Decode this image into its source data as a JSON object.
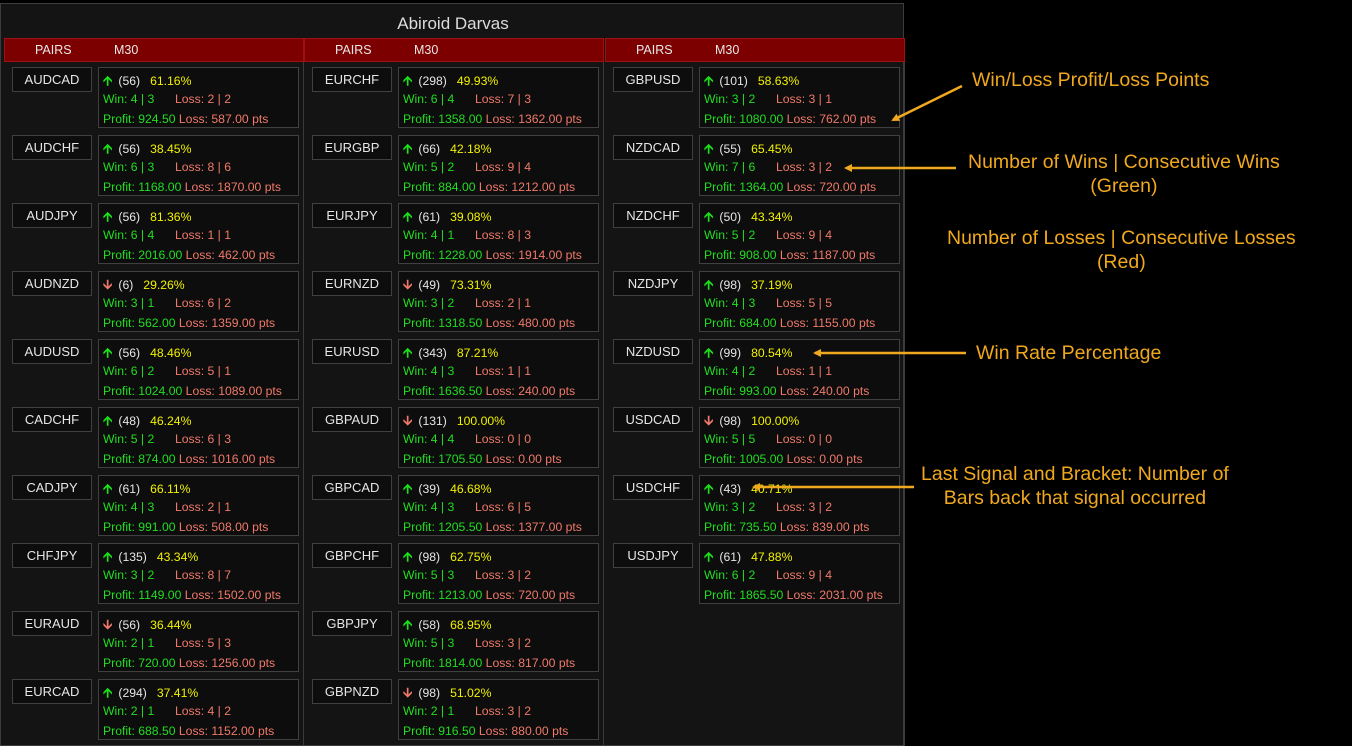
{
  "title": "Abiroid Darvas",
  "header": {
    "pairs_label": "PAIRS",
    "timeframe": "M30"
  },
  "columns": [
    [
      {
        "pair": "AUDCAD",
        "dir": "up",
        "bars": "(56)",
        "rate": "61.16%",
        "win": "Win: 4 | 3",
        "loss": "Loss: 2 | 2",
        "profit": "Profit: 924.50",
        "lossp": "Loss: 587.00 pts"
      },
      {
        "pair": "AUDCHF",
        "dir": "up",
        "bars": "(56)",
        "rate": "38.45%",
        "win": "Win: 6 | 3",
        "loss": "Loss: 8 | 6",
        "profit": "Profit: 1168.00",
        "lossp": "Loss: 1870.00 pts"
      },
      {
        "pair": "AUDJPY",
        "dir": "up",
        "bars": "(56)",
        "rate": "81.36%",
        "win": "Win: 6 | 4",
        "loss": "Loss: 1 | 1",
        "profit": "Profit: 2016.00",
        "lossp": "Loss: 462.00 pts"
      },
      {
        "pair": "AUDNZD",
        "dir": "down",
        "bars": "(6)",
        "rate": "29.26%",
        "win": "Win: 3 | 1",
        "loss": "Loss: 6 | 2",
        "profit": "Profit: 562.00",
        "lossp": "Loss: 1359.00 pts"
      },
      {
        "pair": "AUDUSD",
        "dir": "up",
        "bars": "(56)",
        "rate": "48.46%",
        "win": "Win: 6 | 2",
        "loss": "Loss: 5 | 1",
        "profit": "Profit: 1024.00",
        "lossp": "Loss: 1089.00 pts"
      },
      {
        "pair": "CADCHF",
        "dir": "up",
        "bars": "(48)",
        "rate": "46.24%",
        "win": "Win: 5 | 2",
        "loss": "Loss: 6 | 3",
        "profit": "Profit: 874.00",
        "lossp": "Loss: 1016.00 pts"
      },
      {
        "pair": "CADJPY",
        "dir": "up",
        "bars": "(61)",
        "rate": "66.11%",
        "win": "Win: 4 | 3",
        "loss": "Loss: 2 | 1",
        "profit": "Profit: 991.00",
        "lossp": "Loss: 508.00 pts"
      },
      {
        "pair": "CHFJPY",
        "dir": "up",
        "bars": "(135)",
        "rate": "43.34%",
        "win": "Win: 3 | 2",
        "loss": "Loss: 8 | 7",
        "profit": "Profit: 1149.00",
        "lossp": "Loss: 1502.00 pts"
      },
      {
        "pair": "EURAUD",
        "dir": "down",
        "bars": "(56)",
        "rate": "36.44%",
        "win": "Win: 2 | 1",
        "loss": "Loss: 5 | 3",
        "profit": "Profit: 720.00",
        "lossp": "Loss: 1256.00 pts"
      },
      {
        "pair": "EURCAD",
        "dir": "up",
        "bars": "(294)",
        "rate": "37.41%",
        "win": "Win: 2 | 1",
        "loss": "Loss: 4 | 2",
        "profit": "Profit: 688.50",
        "lossp": "Loss: 1152.00 pts"
      }
    ],
    [
      {
        "pair": "EURCHF",
        "dir": "up",
        "bars": "(298)",
        "rate": "49.93%",
        "win": "Win: 6 | 4",
        "loss": "Loss: 7 | 3",
        "profit": "Profit: 1358.00",
        "lossp": "Loss: 1362.00 pts"
      },
      {
        "pair": "EURGBP",
        "dir": "up",
        "bars": "(66)",
        "rate": "42.18%",
        "win": "Win: 5 | 2",
        "loss": "Loss: 9 | 4",
        "profit": "Profit: 884.00",
        "lossp": "Loss: 1212.00 pts"
      },
      {
        "pair": "EURJPY",
        "dir": "up",
        "bars": "(61)",
        "rate": "39.08%",
        "win": "Win: 4 | 1",
        "loss": "Loss: 8 | 3",
        "profit": "Profit: 1228.00",
        "lossp": "Loss: 1914.00 pts"
      },
      {
        "pair": "EURNZD",
        "dir": "down",
        "bars": "(49)",
        "rate": "73.31%",
        "win": "Win: 3 | 2",
        "loss": "Loss: 2 | 1",
        "profit": "Profit: 1318.50",
        "lossp": "Loss: 480.00 pts"
      },
      {
        "pair": "EURUSD",
        "dir": "up",
        "bars": "(343)",
        "rate": "87.21%",
        "win": "Win: 4 | 3",
        "loss": "Loss: 1 | 1",
        "profit": "Profit: 1636.50",
        "lossp": "Loss: 240.00 pts"
      },
      {
        "pair": "GBPAUD",
        "dir": "down",
        "bars": "(131)",
        "rate": "100.00%",
        "win": "Win: 4 | 4",
        "loss": "Loss: 0 | 0",
        "profit": "Profit: 1705.50",
        "lossp": "Loss: 0.00 pts"
      },
      {
        "pair": "GBPCAD",
        "dir": "up",
        "bars": "(39)",
        "rate": "46.68%",
        "win": "Win: 4 | 3",
        "loss": "Loss: 6 | 5",
        "profit": "Profit: 1205.50",
        "lossp": "Loss: 1377.00 pts"
      },
      {
        "pair": "GBPCHF",
        "dir": "up",
        "bars": "(98)",
        "rate": "62.75%",
        "win": "Win: 5 | 3",
        "loss": "Loss: 3 | 2",
        "profit": "Profit: 1213.00",
        "lossp": "Loss: 720.00 pts"
      },
      {
        "pair": "GBPJPY",
        "dir": "up",
        "bars": "(58)",
        "rate": "68.95%",
        "win": "Win: 5 | 3",
        "loss": "Loss: 3 | 2",
        "profit": "Profit: 1814.00",
        "lossp": "Loss: 817.00 pts"
      },
      {
        "pair": "GBPNZD",
        "dir": "down",
        "bars": "(98)",
        "rate": "51.02%",
        "win": "Win: 2 | 1",
        "loss": "Loss: 3 | 2",
        "profit": "Profit: 916.50",
        "lossp": "Loss: 880.00 pts"
      }
    ],
    [
      {
        "pair": "GBPUSD",
        "dir": "up",
        "bars": "(101)",
        "rate": "58.63%",
        "win": "Win: 3 | 2",
        "loss": "Loss: 3 | 1",
        "profit": "Profit: 1080.00",
        "lossp": "Loss: 762.00 pts"
      },
      {
        "pair": "NZDCAD",
        "dir": "up",
        "bars": "(55)",
        "rate": "65.45%",
        "win": "Win: 7 | 6",
        "loss": "Loss: 3 | 2",
        "profit": "Profit: 1364.00",
        "lossp": "Loss: 720.00 pts"
      },
      {
        "pair": "NZDCHF",
        "dir": "up",
        "bars": "(50)",
        "rate": "43.34%",
        "win": "Win: 5 | 2",
        "loss": "Loss: 9 | 4",
        "profit": "Profit: 908.00",
        "lossp": "Loss: 1187.00 pts"
      },
      {
        "pair": "NZDJPY",
        "dir": "up",
        "bars": "(98)",
        "rate": "37.19%",
        "win": "Win: 4 | 3",
        "loss": "Loss: 5 | 5",
        "profit": "Profit: 684.00",
        "lossp": "Loss: 1155.00 pts"
      },
      {
        "pair": "NZDUSD",
        "dir": "up",
        "bars": "(99)",
        "rate": "80.54%",
        "win": "Win: 4 | 2",
        "loss": "Loss: 1 | 1",
        "profit": "Profit: 993.00",
        "lossp": "Loss: 240.00 pts"
      },
      {
        "pair": "USDCAD",
        "dir": "down",
        "bars": "(98)",
        "rate": "100.00%",
        "win": "Win: 5 | 5",
        "loss": "Loss: 0 | 0",
        "profit": "Profit: 1005.00",
        "lossp": "Loss: 0.00 pts"
      },
      {
        "pair": "USDCHF",
        "dir": "up",
        "bars": "(43)",
        "rate": "40.71%",
        "win": "Win: 3 | 2",
        "loss": "Loss: 3 | 2",
        "profit": "Profit: 735.50",
        "lossp": "Loss: 839.00 pts"
      },
      {
        "pair": "USDJPY",
        "dir": "up",
        "bars": "(61)",
        "rate": "47.88%",
        "win": "Win: 6 | 2",
        "loss": "Loss: 9 | 4",
        "profit": "Profit: 1865.50",
        "lossp": "Loss: 2031.00 pts"
      }
    ]
  ],
  "annotations": {
    "profit_loss": "Win/Loss Profit/Loss Points",
    "wins_1": "Number of Wins | Consecutive Wins",
    "wins_2": "(Green)",
    "losses_1": "Number of Losses | Consecutive Losses",
    "losses_2": "(Red)",
    "winrate": "Win Rate Percentage",
    "signal_1": "Last Signal and Bracket: Number of",
    "signal_2": "Bars back that signal occurred"
  },
  "colors": {
    "accent": "#f0a81e",
    "header_red": "#7d0000",
    "win_green": "#22dd22",
    "loss_red": "#f07a6a",
    "rate_yellow": "#f2f200"
  }
}
